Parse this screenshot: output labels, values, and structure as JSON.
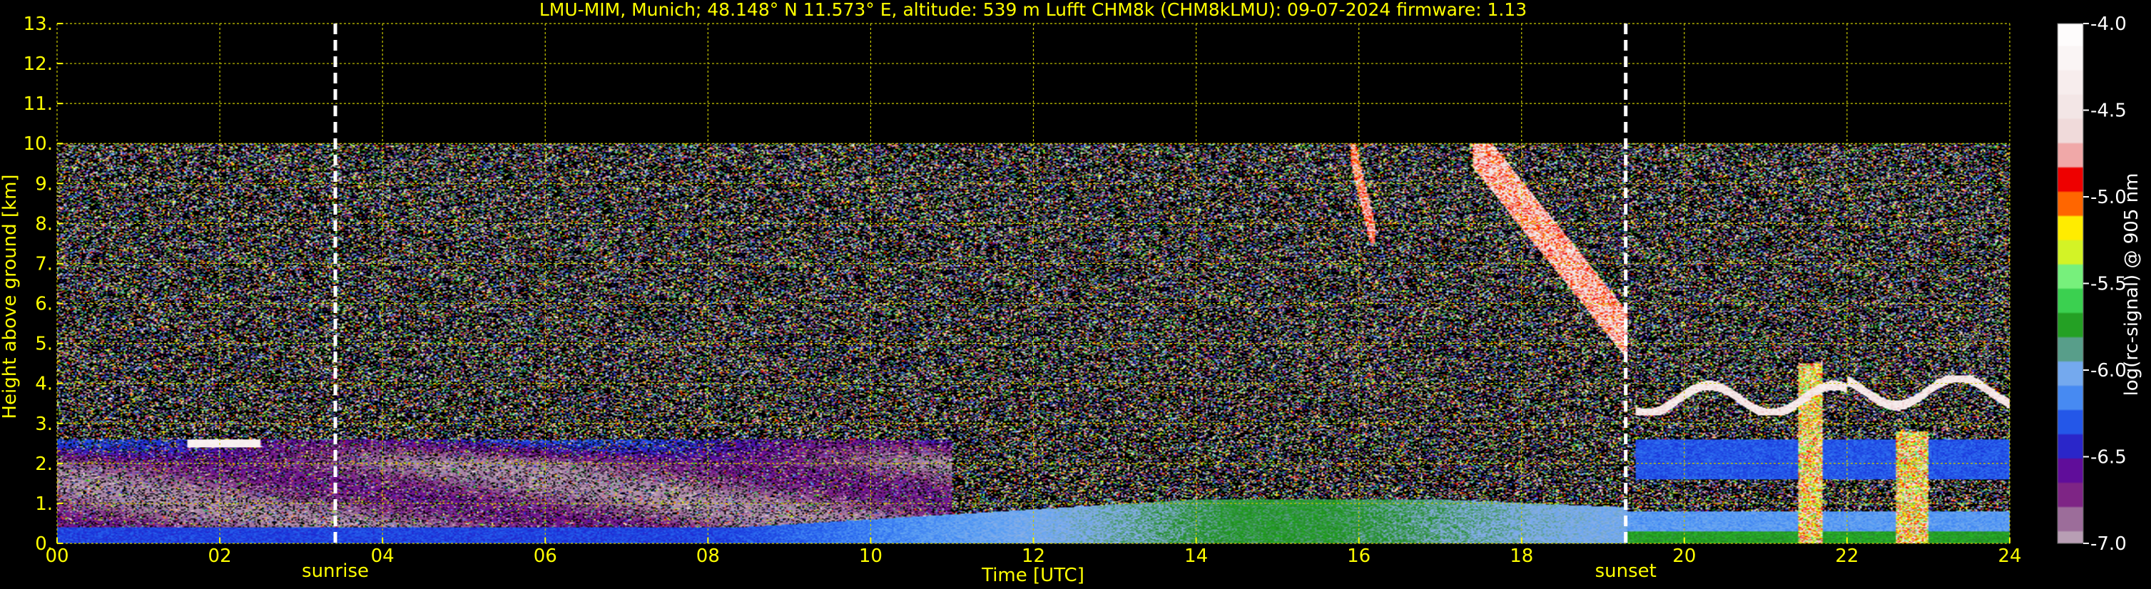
{
  "chart_data": {
    "type": "heatmap",
    "title": "LMU-MIM, Munich; 48.148° N 11.573° E, altitude: 539 m    Lufft CHM8k (CHM8kLMU): 09-07-2024    firmware: 1.13",
    "xlabel": "Time [UTC]",
    "ylabel": "Height above ground [km]",
    "xlim": [
      0,
      24
    ],
    "ylim": [
      0,
      13
    ],
    "x_ticks": [
      "00",
      "02",
      "04",
      "06",
      "08",
      "10",
      "12",
      "14",
      "16",
      "18",
      "20",
      "22",
      "24"
    ],
    "y_ticks": [
      "0.",
      "1.",
      "2.",
      "3.",
      "4.",
      "5.",
      "6.",
      "7.",
      "8.",
      "9.",
      "10.",
      "11.",
      "12.",
      "13."
    ],
    "grid": true,
    "data_top_km": 10,
    "events": [
      {
        "label": "sunrise",
        "time_utc": 3.42
      },
      {
        "label": "sunset",
        "time_utc": 19.28
      }
    ],
    "colorbar": {
      "label": "log(rc-signal) @ 905 nm",
      "range": [
        -7.0,
        -4.0
      ],
      "ticks": [
        "-4.0",
        "-4.5",
        "-5.0",
        "-5.5",
        "-6.0",
        "-6.5",
        "-7.0"
      ],
      "tick_values": [
        -4.0,
        -4.5,
        -5.0,
        -5.5,
        -6.0,
        -6.5,
        -7.0
      ],
      "stops": [
        {
          "v": -7.0,
          "c": "#b89eb4"
        },
        {
          "v": -6.85,
          "c": "#9a6a98"
        },
        {
          "v": -6.7,
          "c": "#7a1a82"
        },
        {
          "v": -6.55,
          "c": "#5a0aa0"
        },
        {
          "v": -6.4,
          "c": "#1830d8"
        },
        {
          "v": -6.25,
          "c": "#2a6af0"
        },
        {
          "v": -6.1,
          "c": "#5aa0f4"
        },
        {
          "v": -5.95,
          "c": "#8ab0e8"
        },
        {
          "v": -5.8,
          "c": "#1e8a1e"
        },
        {
          "v": -5.65,
          "c": "#2cc02c"
        },
        {
          "v": -5.5,
          "c": "#5af098"
        },
        {
          "v": -5.35,
          "c": "#c8f030"
        },
        {
          "v": -5.2,
          "c": "#ffff00"
        },
        {
          "v": -5.1,
          "c": "#ffa000"
        },
        {
          "v": -5.0,
          "c": "#ff4000"
        },
        {
          "v": -4.9,
          "c": "#ee0000"
        },
        {
          "v": -4.75,
          "c": "#f0b4b4"
        },
        {
          "v": -4.6,
          "c": "#f0e0e0"
        },
        {
          "v": -4.0,
          "c": "#ffffff"
        }
      ]
    },
    "features": [
      {
        "kind": "boundary_layer",
        "time": [
          0,
          24
        ],
        "height_km": [
          0.0,
          0.4
        ],
        "level": -6.35
      },
      {
        "kind": "residual_layer",
        "time": [
          0,
          11
        ],
        "height_km": [
          0.4,
          2.6
        ],
        "level": -6.8
      },
      {
        "kind": "mixing_layer",
        "time": [
          8,
          19.3
        ],
        "height_km": [
          0.0,
          1.1
        ],
        "level": -6.1
      },
      {
        "kind": "evening_boundary_layer",
        "time": [
          19.3,
          24
        ],
        "height_km": [
          0.0,
          0.8
        ],
        "level": -5.8
      },
      {
        "kind": "aerosol_layer",
        "time": [
          1.6,
          2.5
        ],
        "height_km": [
          2.4,
          2.6
        ],
        "level": -4.5
      },
      {
        "kind": "cirrus_fallstreak",
        "time": [
          15.9,
          16.2
        ],
        "height_km": [
          7.5,
          10.0
        ],
        "level": -4.8
      },
      {
        "kind": "descending_cloud",
        "time": [
          17.4,
          19.3
        ],
        "height_km": [
          4.6,
          10.0
        ],
        "level": -4.4
      },
      {
        "kind": "cloud_layer",
        "time": [
          19.4,
          24
        ],
        "height_km": [
          3.2,
          4.2
        ],
        "level": -4.5
      },
      {
        "kind": "elevated_aerosol",
        "time": [
          19.4,
          24
        ],
        "height_km": [
          1.6,
          2.6
        ],
        "level": -6.3
      },
      {
        "kind": "precipitation_column",
        "time": [
          21.4,
          21.7
        ],
        "height_km": [
          0.0,
          4.5
        ],
        "level": -5.2
      },
      {
        "kind": "precipitation_column",
        "time": [
          22.6,
          23.0
        ],
        "height_km": [
          0.0,
          2.8
        ],
        "level": -5.2
      }
    ]
  }
}
